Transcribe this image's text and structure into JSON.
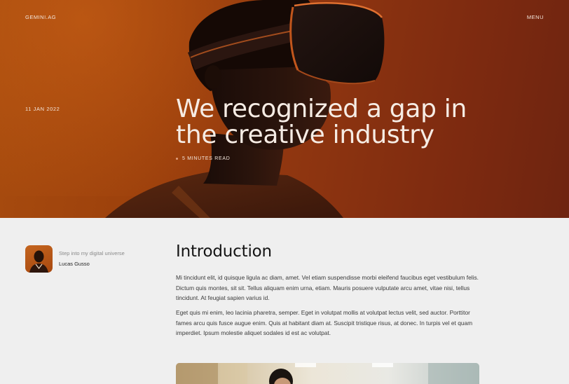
{
  "header": {
    "brand": "GEMINI.AG",
    "menu_label": "MENU"
  },
  "hero": {
    "date": "11 JAN 2022",
    "title": "We recognized a gap in the creative industry",
    "read_time": "5 MINUTES READ"
  },
  "author": {
    "tagline": "Step into my digital universe",
    "name": "Lucas Gusso"
  },
  "article": {
    "heading": "Introduction",
    "paragraphs": [
      "Mi tincidunt elit, id quisque ligula ac diam, amet. Vel etiam suspendisse morbi eleifend faucibus eget vestibulum felis. Dictum quis montes, sit sit. Tellus aliquam enim urna, etiam. Mauris posuere vulputate arcu amet, vitae nisi, tellus tincidunt. At feugiat sapien varius id.",
      "Eget quis mi enim, leo lacinia pharetra, semper. Eget in volutpat mollis at volutpat lectus velit, sed auctor. Porttitor fames arcu quis fusce augue enim. Quis at habitant diam at. Suscipit tristique risus, at donec. In turpis vel et quam imperdiet. Ipsum molestie aliquet sodales id est ac volutpat."
    ]
  },
  "colors": {
    "hero_orange": "#9c400c",
    "page_background": "#efefef",
    "text_dark": "#141414"
  }
}
